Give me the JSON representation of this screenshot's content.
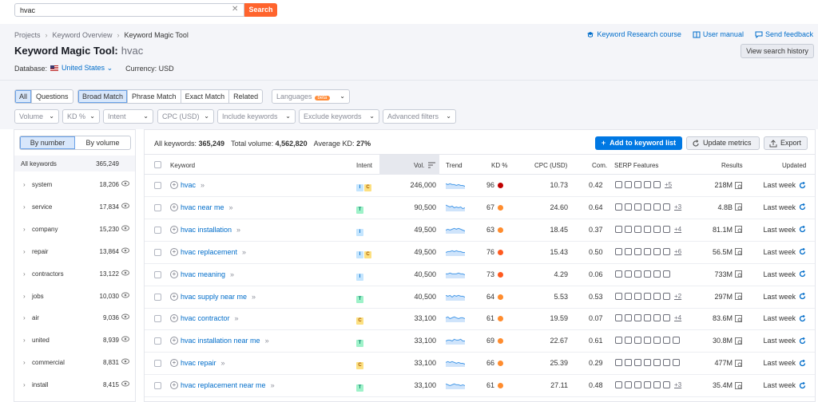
{
  "search": {
    "value": "hvac",
    "button": "Search"
  },
  "breadcrumb": [
    "Projects",
    "Keyword Overview",
    "Keyword Magic Tool"
  ],
  "title": {
    "tool": "Keyword Magic Tool:",
    "keyword": "hvac"
  },
  "database": {
    "label": "Database:",
    "country": "United States",
    "currency": "Currency: USD"
  },
  "header_links": {
    "course": "Keyword Research course",
    "manual": "User manual",
    "feedback": "Send feedback",
    "history": "View search history"
  },
  "filters": {
    "type_tabs": [
      "All",
      "Questions"
    ],
    "match_tabs": [
      "Broad Match",
      "Phrase Match",
      "Exact Match",
      "Related"
    ],
    "languages": "Languages",
    "beta": "beta",
    "row2": [
      "Volume",
      "KD %",
      "Intent",
      "CPC (USD)",
      "Include keywords",
      "Exclude keywords",
      "Advanced filters"
    ]
  },
  "sidebar": {
    "toggle": [
      "By number",
      "By volume"
    ],
    "all_label": "All keywords",
    "all_count": "365,249",
    "groups": [
      {
        "name": "system",
        "count": "18,206"
      },
      {
        "name": "service",
        "count": "17,834"
      },
      {
        "name": "company",
        "count": "15,230"
      },
      {
        "name": "repair",
        "count": "13,864"
      },
      {
        "name": "contractors",
        "count": "13,122"
      },
      {
        "name": "jobs",
        "count": "10,030"
      },
      {
        "name": "air",
        "count": "9,036"
      },
      {
        "name": "united",
        "count": "8,939"
      },
      {
        "name": "commercial",
        "count": "8,831"
      },
      {
        "name": "install",
        "count": "8,415"
      }
    ]
  },
  "summary": {
    "all_label": "All keywords:",
    "all_value": "365,249",
    "vol_label": "Total volume:",
    "vol_value": "4,562,820",
    "kd_label": "Average KD:",
    "kd_value": "27%"
  },
  "actions": {
    "add": "Add to keyword list",
    "update": "Update metrics",
    "export": "Export"
  },
  "columns": [
    "Keyword",
    "Intent",
    "Vol.",
    "Trend",
    "KD %",
    "CPC (USD)",
    "Com.",
    "SERP Features",
    "Results",
    "Updated"
  ],
  "rows": [
    {
      "keyword": "hvac",
      "intent": [
        "I",
        "C"
      ],
      "volume": "246,000",
      "kd": "96",
      "kd_color": "#c00000",
      "cpc": "10.73",
      "com": "0.42",
      "serp_icons": 5,
      "serp_more": "+5",
      "results": "218M",
      "updated": "Last week",
      "trend": [
        6,
        5,
        6,
        5,
        5,
        4,
        5,
        4,
        4,
        3
      ]
    },
    {
      "keyword": "hvac near me",
      "intent": [
        "T"
      ],
      "volume": "90,500",
      "kd": "67",
      "kd_color": "#ff8c2e",
      "cpc": "24.60",
      "com": "0.64",
      "serp_icons": 6,
      "serp_more": "+3",
      "results": "4.8B",
      "updated": "Last week",
      "trend": [
        7,
        6,
        5,
        6,
        4,
        5,
        4,
        5,
        3,
        4
      ]
    },
    {
      "keyword": "hvac installation",
      "intent": [
        "I"
      ],
      "volume": "49,500",
      "kd": "63",
      "kd_color": "#ff8c2e",
      "cpc": "18.45",
      "com": "0.37",
      "serp_icons": 6,
      "serp_more": "+4",
      "results": "81.1M",
      "updated": "Last week",
      "trend": [
        4,
        5,
        4,
        5,
        6,
        5,
        6,
        5,
        4,
        3
      ]
    },
    {
      "keyword": "hvac replacement",
      "intent": [
        "I",
        "C"
      ],
      "volume": "49,500",
      "kd": "76",
      "kd_color": "#ff5a1f",
      "cpc": "15.43",
      "com": "0.50",
      "serp_icons": 6,
      "serp_more": "+6",
      "results": "56.5M",
      "updated": "Last week",
      "trend": [
        4,
        5,
        5,
        6,
        5,
        6,
        5,
        5,
        4,
        4
      ]
    },
    {
      "keyword": "hvac meaning",
      "intent": [
        "I"
      ],
      "volume": "40,500",
      "kd": "73",
      "kd_color": "#ff5a1f",
      "cpc": "4.29",
      "com": "0.06",
      "serp_icons": 6,
      "serp_more": "",
      "results": "733M",
      "updated": "Last week",
      "trend": [
        5,
        5,
        6,
        5,
        5,
        5,
        6,
        5,
        5,
        4
      ]
    },
    {
      "keyword": "hvac supply near me",
      "intent": [
        "T"
      ],
      "volume": "40,500",
      "kd": "64",
      "kd_color": "#ff8c2e",
      "cpc": "5.53",
      "com": "0.53",
      "serp_icons": 6,
      "serp_more": "+2",
      "results": "297M",
      "updated": "Last week",
      "trend": [
        6,
        5,
        6,
        4,
        6,
        5,
        6,
        5,
        5,
        4
      ]
    },
    {
      "keyword": "hvac contractor",
      "intent": [
        "C"
      ],
      "volume": "33,100",
      "kd": "61",
      "kd_color": "#ff8c2e",
      "cpc": "19.59",
      "com": "0.07",
      "serp_icons": 6,
      "serp_more": "+4",
      "results": "83.6M",
      "updated": "Last week",
      "trend": [
        5,
        6,
        4,
        5,
        6,
        5,
        4,
        5,
        5,
        4
      ]
    },
    {
      "keyword": "hvac installation near me",
      "intent": [
        "T"
      ],
      "volume": "33,100",
      "kd": "69",
      "kd_color": "#ff8c2e",
      "cpc": "22.67",
      "com": "0.61",
      "serp_icons": 7,
      "serp_more": "",
      "results": "30.8M",
      "updated": "Last week",
      "trend": [
        4,
        5,
        5,
        4,
        6,
        5,
        5,
        6,
        4,
        4
      ]
    },
    {
      "keyword": "hvac repair",
      "intent": [
        "C"
      ],
      "volume": "33,100",
      "kd": "66",
      "kd_color": "#ff8c2e",
      "cpc": "25.39",
      "com": "0.29",
      "serp_icons": 7,
      "serp_more": "",
      "results": "477M",
      "updated": "Last week",
      "trend": [
        5,
        6,
        5,
        6,
        5,
        4,
        5,
        4,
        4,
        3
      ]
    },
    {
      "keyword": "hvac replacement near me",
      "intent": [
        "T"
      ],
      "volume": "33,100",
      "kd": "61",
      "kd_color": "#ff8c2e",
      "cpc": "27.11",
      "com": "0.48",
      "serp_icons": 6,
      "serp_more": "+3",
      "results": "35.4M",
      "updated": "Last week",
      "trend": [
        6,
        5,
        4,
        5,
        6,
        5,
        5,
        4,
        5,
        4
      ]
    }
  ]
}
